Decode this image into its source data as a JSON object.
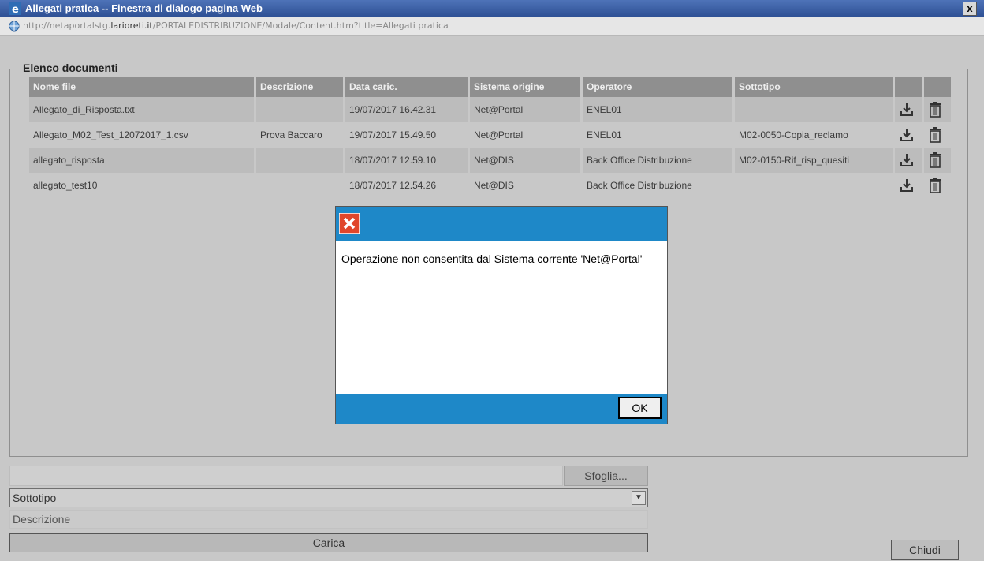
{
  "window": {
    "title": "Allegati pratica -- Finestra di dialogo pagina Web",
    "close_glyph": "x",
    "url_prefix": "http://netaportalstg.",
    "url_domain": "larioreti.it",
    "url_suffix": "/PORTALEDISTRIBUZIONE/Modale/Content.htm?title=Allegati pratica"
  },
  "documents": {
    "legend": "Elenco documenti",
    "columns": [
      "Nome file",
      "Descrizione",
      "Data caric.",
      "Sistema origine",
      "Operatore",
      "Sottotipo"
    ],
    "rows": [
      {
        "nome_file": "Allegato_di_Risposta.txt",
        "descrizione": "",
        "data": "19/07/2017 16.42.31",
        "sistema": "Net@Portal",
        "operatore": "ENEL01",
        "sottotipo": ""
      },
      {
        "nome_file": "Allegato_M02_Test_12072017_1.csv",
        "descrizione": "Prova Baccaro",
        "data": "19/07/2017 15.49.50",
        "sistema": "Net@Portal",
        "operatore": "ENEL01",
        "sottotipo": "M02-0050-Copia_reclamo"
      },
      {
        "nome_file": "allegato_risposta",
        "descrizione": "",
        "data": "18/07/2017 12.59.10",
        "sistema": "Net@DIS",
        "operatore": "Back Office Distribuzione",
        "sottotipo": "M02-0150-Rif_risp_quesiti"
      },
      {
        "nome_file": "allegato_test10",
        "descrizione": "",
        "data": "18/07/2017 12.54.26",
        "sistema": "Net@DIS",
        "operatore": "Back Office Distribuzione",
        "sottotipo": ""
      }
    ]
  },
  "form": {
    "browse_label": "Sfoglia...",
    "subtype_value": "Sottotipo",
    "description_placeholder": "Descrizione",
    "upload_label": "Carica",
    "close_label": "Chiudi"
  },
  "alert": {
    "message": "Operazione non consentita dal Sistema corrente 'Net@Portal'",
    "ok_label": "OK"
  },
  "colors": {
    "alert_bar": "#1e88c8",
    "title_bar": "#2d4f93",
    "error_icon": "#e0462b"
  }
}
